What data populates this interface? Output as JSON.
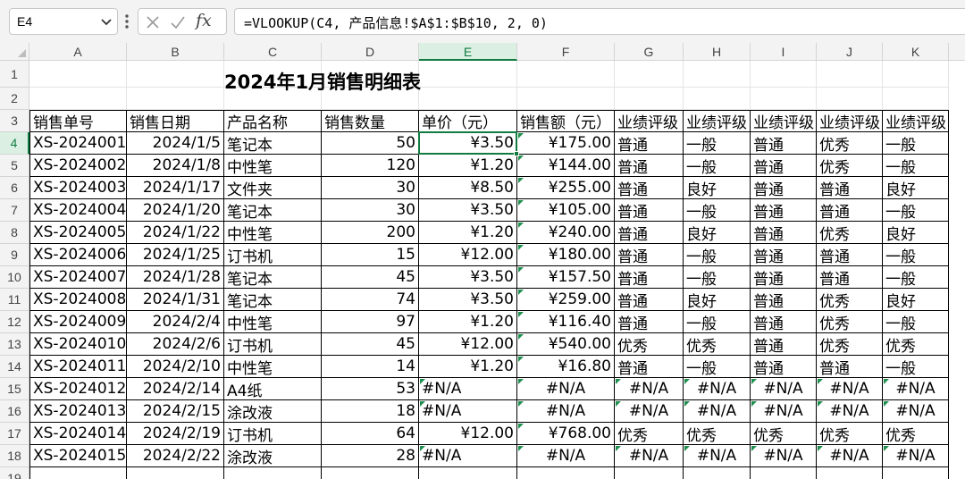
{
  "formula_bar": {
    "name_box": "E4",
    "formula": "=VLOOKUP(C4, 产品信息!$A$1:$B$10, 2, 0)",
    "fx_label": "fx"
  },
  "sheet": {
    "columns": [
      "A",
      "B",
      "C",
      "D",
      "E",
      "F",
      "G",
      "H",
      "I",
      "J",
      "K"
    ],
    "selected_column": "E",
    "selected_row": 4,
    "title": "2024年1月销售明细表",
    "headers": [
      "销售单号",
      "销售日期",
      "产品名称",
      "销售数量",
      "单价（元）",
      "销售额（元）",
      "业绩评级",
      "业绩评级",
      "业绩评级",
      "业绩评级",
      "业绩评级"
    ],
    "rows": [
      [
        "XS-2024001",
        "2024/1/5",
        "笔记本",
        "50",
        "¥3.50",
        "¥175.00",
        "普通",
        "一般",
        "普通",
        "优秀",
        "一般"
      ],
      [
        "XS-2024002",
        "2024/1/8",
        "中性笔",
        "120",
        "¥1.20",
        "¥144.00",
        "普通",
        "一般",
        "普通",
        "优秀",
        "一般"
      ],
      [
        "XS-2024003",
        "2024/1/17",
        "文件夹",
        "30",
        "¥8.50",
        "¥255.00",
        "普通",
        "良好",
        "普通",
        "普通",
        "良好"
      ],
      [
        "XS-2024004",
        "2024/1/20",
        "笔记本",
        "30",
        "¥3.50",
        "¥105.00",
        "普通",
        "一般",
        "普通",
        "普通",
        "一般"
      ],
      [
        "XS-2024005",
        "2024/1/22",
        "中性笔",
        "200",
        "¥1.20",
        "¥240.00",
        "普通",
        "良好",
        "普通",
        "优秀",
        "良好"
      ],
      [
        "XS-2024006",
        "2024/1/25",
        "订书机",
        "15",
        "¥12.00",
        "¥180.00",
        "普通",
        "一般",
        "普通",
        "普通",
        "一般"
      ],
      [
        "XS-2024007",
        "2024/1/28",
        "笔记本",
        "45",
        "¥3.50",
        "¥157.50",
        "普通",
        "一般",
        "普通",
        "普通",
        "一般"
      ],
      [
        "XS-2024008",
        "2024/1/31",
        "笔记本",
        "74",
        "¥3.50",
        "¥259.00",
        "普通",
        "良好",
        "普通",
        "优秀",
        "良好"
      ],
      [
        "XS-2024009",
        "2024/2/4",
        "中性笔",
        "97",
        "¥1.20",
        "¥116.40",
        "普通",
        "一般",
        "普通",
        "优秀",
        "一般"
      ],
      [
        "XS-2024010",
        "2024/2/6",
        "订书机",
        "45",
        "¥12.00",
        "¥540.00",
        "优秀",
        "优秀",
        "普通",
        "优秀",
        "优秀"
      ],
      [
        "XS-2024011",
        "2024/2/10",
        "中性笔",
        "14",
        "¥1.20",
        "¥16.80",
        "普通",
        "一般",
        "普通",
        "普通",
        "一般"
      ],
      [
        "XS-2024012",
        "2024/2/14",
        "A4纸",
        "53",
        "#N/A",
        "#N/A",
        "#N/A",
        "#N/A",
        "#N/A",
        "#N/A",
        "#N/A"
      ],
      [
        "XS-2024013",
        "2024/2/15",
        "涂改液",
        "18",
        "#N/A",
        "#N/A",
        "#N/A",
        "#N/A",
        "#N/A",
        "#N/A",
        "#N/A"
      ],
      [
        "XS-2024014",
        "2024/2/19",
        "订书机",
        "64",
        "¥12.00",
        "¥768.00",
        "优秀",
        "优秀",
        "优秀",
        "优秀",
        "优秀"
      ],
      [
        "XS-2024015",
        "2024/2/22",
        "涂改液",
        "28",
        "#N/A",
        "#N/A",
        "#N/A",
        "#N/A",
        "#N/A",
        "#N/A",
        "#N/A"
      ]
    ]
  }
}
